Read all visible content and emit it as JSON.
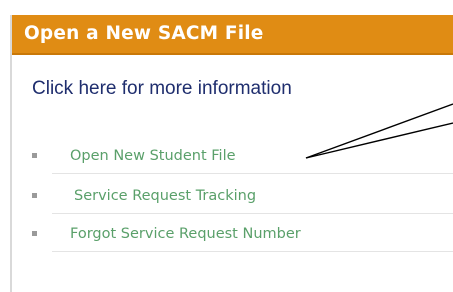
{
  "panel": {
    "title": "Open a New SACM File",
    "info_link": "Click here for more information",
    "items": [
      {
        "label": "Open New Student File"
      },
      {
        "label": "Service Request Tracking"
      },
      {
        "label": "Forgot Service Request Number"
      }
    ]
  },
  "colors": {
    "header_bg": "#e08c14",
    "header_text": "#ffffff",
    "link_text": "#1f2e6e",
    "item_text": "#5aa06a",
    "bullet": "#9a9a9a",
    "callout_line": "#000000"
  },
  "icons": [
    "square-bullet-icon"
  ]
}
